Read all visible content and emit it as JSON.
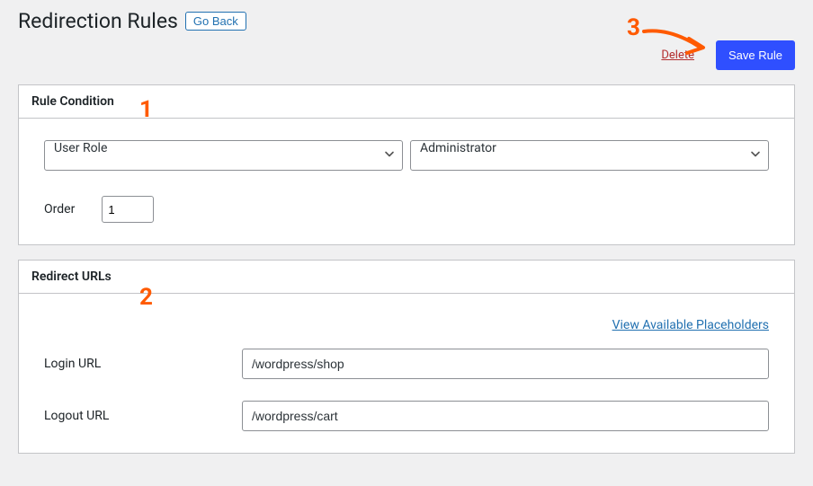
{
  "header": {
    "title": "Redirection Rules",
    "go_back": "Go Back"
  },
  "actions": {
    "delete": "Delete",
    "save": "Save Rule"
  },
  "rule_condition": {
    "title": "Rule Condition",
    "condition_type": "User Role",
    "role_value": "Administrator",
    "order_label": "Order",
    "order_value": "1"
  },
  "redirect_urls": {
    "title": "Redirect URLs",
    "placeholders_link": "View Available Placeholders",
    "login_label": "Login URL",
    "login_value": "/wordpress/shop",
    "logout_label": "Logout URL",
    "logout_value": "/wordpress/cart"
  },
  "annotations": {
    "n1": "1",
    "n2": "2",
    "n3": "3"
  }
}
